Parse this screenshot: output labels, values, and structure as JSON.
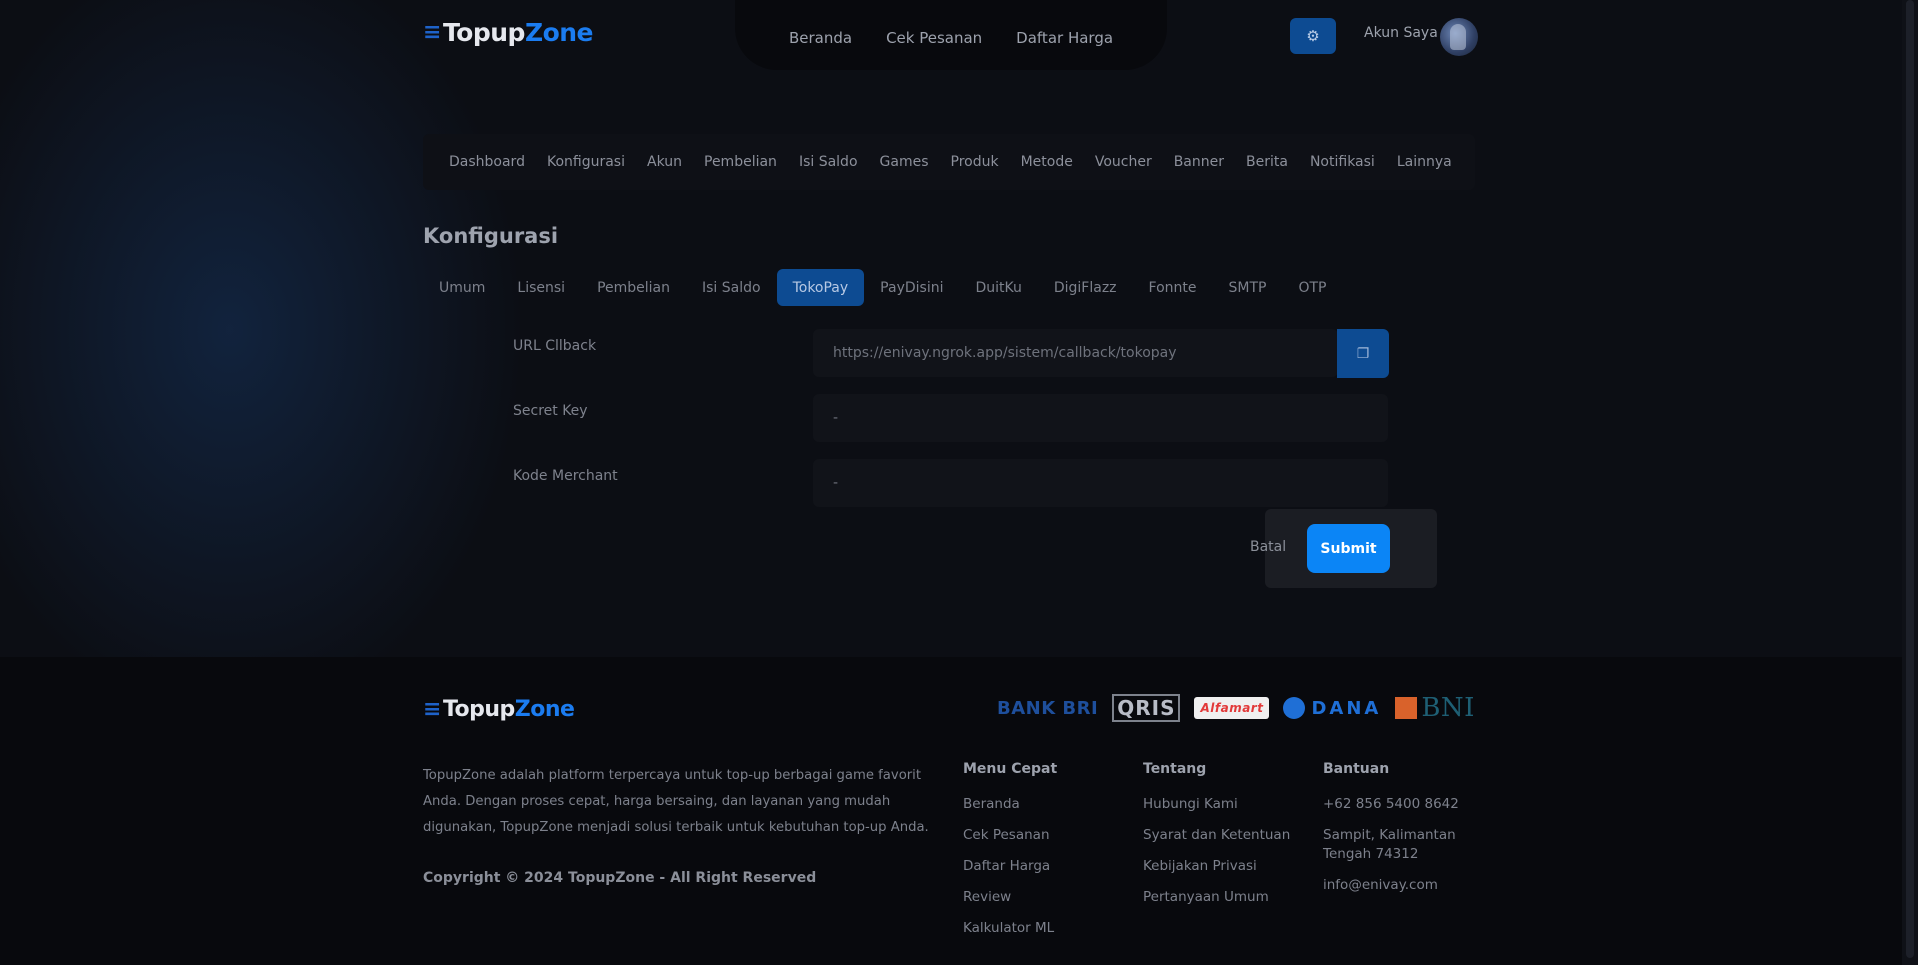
{
  "brand": {
    "part1": "Topup",
    "part2": "Zone"
  },
  "header": {
    "nav": [
      "Beranda",
      "Cek Pesanan",
      "Daftar Harga"
    ],
    "settings_icon": "gear-icon",
    "account_label": "Akun Saya"
  },
  "admin_menu": [
    "Dashboard",
    "Konfigurasi",
    "Akun",
    "Pembelian",
    "Isi Saldo",
    "Games",
    "Produk",
    "Metode",
    "Voucher",
    "Banner",
    "Berita",
    "Notifikasi",
    "Lainnya"
  ],
  "page_title": "Konfigurasi",
  "tabs": [
    "Umum",
    "Lisensi",
    "Pembelian",
    "Isi Saldo",
    "TokoPay",
    "PayDisini",
    "DuitKu",
    "DigiFlazz",
    "Fonnte",
    "SMTP",
    "OTP"
  ],
  "active_tab": "TokoPay",
  "form": {
    "callback_label": "URL Cllback",
    "callback_value": "https://enivay.ngrok.app/sistem/callback/tokopay",
    "copy_icon": "copy-icon",
    "secret_label": "Secret Key",
    "secret_value": "-",
    "merchant_label": "Kode Merchant",
    "merchant_value": "-",
    "cancel_label": "Batal",
    "submit_label": "Submit"
  },
  "footer": {
    "payment_logos": [
      "BANK BRI",
      "QRIS",
      "Alfamart",
      "DANA",
      "BNI"
    ],
    "about": "TopupZone adalah platform terpercaya untuk top-up berbagai game favorit Anda. Dengan proses cepat, harga bersaing, dan layanan yang mudah digunakan, TopupZone menjadi solusi terbaik untuk kebutuhan top-up Anda.",
    "copyright": "Copyright © 2024 TopupZone - All Right Reserved",
    "menu_cepat": {
      "title": "Menu Cepat",
      "items": [
        "Beranda",
        "Cek Pesanan",
        "Daftar Harga",
        "Review",
        "Kalkulator ML"
      ]
    },
    "tentang": {
      "title": "Tentang",
      "items": [
        "Hubungi Kami",
        "Syarat dan Ketentuan",
        "Kebijakan Privasi",
        "Pertanyaan Umum"
      ]
    },
    "bantuan": {
      "title": "Bantuan",
      "phone": "+62 856 5400 8642",
      "address": "Sampit, Kalimantan Tengah 74312",
      "email": "info@enivay.com"
    }
  },
  "colors": {
    "accent": "#0b85f6",
    "active_tab": "#0d4b92",
    "background": "#0c0e14"
  }
}
